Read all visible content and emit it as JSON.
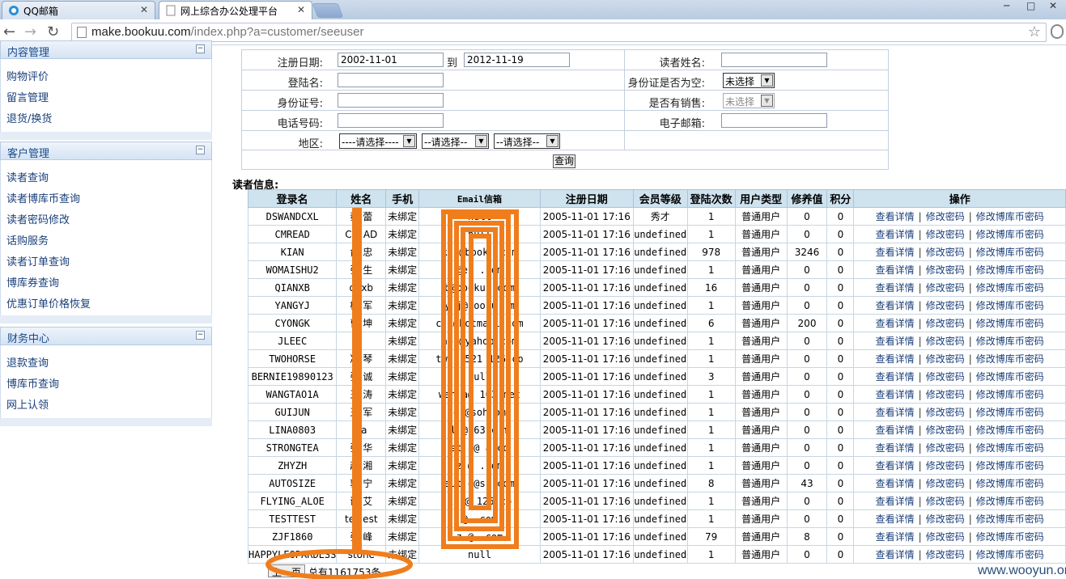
{
  "browser": {
    "tabs": [
      {
        "title": "QQ邮箱",
        "active": false
      },
      {
        "title": "网上综合办公处理平台",
        "active": true
      }
    ],
    "url_host": "make.bookuu.com",
    "url_path": "/index.php?a=customer/seeuser",
    "window_controls": [
      "─",
      "□",
      "✕"
    ]
  },
  "sidebar": {
    "sections": [
      {
        "title": "内容管理",
        "items": [
          "购物评价",
          "留言管理",
          "退货/换货"
        ]
      },
      {
        "title": "客户管理",
        "items": [
          "读者查询",
          "读者博库币查询",
          "读者密码修改",
          "话购服务",
          "读者订单查询",
          "博库券查询",
          "优惠订单价格恢复"
        ]
      },
      {
        "title": "财务中心",
        "items": [
          "退款查询",
          "博库币查询",
          "网上认领"
        ]
      }
    ]
  },
  "form": {
    "reg_date_label": "注册日期:",
    "reg_date_from": "2002-11-01",
    "to_label": "到",
    "reg_date_to": "2012-11-19",
    "reader_name_label": "读者姓名:",
    "login_label": "登陆名:",
    "idcard_empty_label": "身份证是否为空:",
    "idcard_empty_value": "未选择",
    "idcard_label": "身份证号:",
    "has_sale_label": "是否有销售:",
    "has_sale_value": "未选择",
    "phone_label": "电话号码:",
    "email_label": "电子邮箱:",
    "region_label": "地区:",
    "region_sel1": "----请选择----",
    "region_sel2": "--请选择--",
    "region_sel3": "--请选择--",
    "query_button": "查询"
  },
  "section_title": "读者信息:",
  "table": {
    "headers": [
      "登录名",
      "姓名",
      "手机",
      "Email信箱",
      "注册日期",
      "会员等级",
      "登陆次数",
      "用户类型",
      "修养值",
      "积分",
      "操作"
    ],
    "rows": [
      [
        "DSWANDCXL",
        "蔡 蕾",
        "未绑定",
        "null",
        "2005-11-01 17:16",
        "秀才",
        "1",
        "普通用户",
        "0",
        "0"
      ],
      [
        "CMREAD",
        "CM AD",
        "未绑定",
        "null",
        "2005-11-01 17:16",
        "undefined",
        "1",
        "普通用户",
        "0",
        "0"
      ],
      [
        "KIAN",
        "俞 忠",
        "未绑定",
        "k  n@book  .c m",
        "2005-11-01 17:16",
        "undefined",
        "978",
        "普通用户",
        "3246",
        "0"
      ],
      [
        "WOMAISHU2",
        "张 生",
        "未绑定",
        "  @es  .com",
        "2005-11-01 17:16",
        "undefined",
        "1",
        "普通用户",
        "0",
        "0"
      ],
      [
        "QIANXB",
        "qi  xb",
        "未绑定",
        "  b@booku  .com",
        "2005-11-01 17:16",
        "undefined",
        "16",
        "普通用户",
        "0",
        "0"
      ],
      [
        "YANGYJ",
        "杨 军",
        "未绑定",
        "y  j@boo  u.  m",
        "2005-11-01 17:16",
        "undefined",
        "1",
        "普通用户",
        "0",
        "0"
      ],
      [
        "CYONGK",
        "曹 坤",
        "未绑定",
        "c  k@hotma l.com",
        "2005-11-01 17:16",
        "undefined",
        "6",
        "普通用户",
        "200",
        "0"
      ],
      [
        "JLEEC",
        "",
        "未绑定",
        "ap  @yahoo.com",
        "2005-11-01 17:16",
        "undefined",
        "1",
        "普通用户",
        "0",
        "0"
      ],
      [
        "TWOHORSE",
        "冯 琴",
        "未绑定",
        "tw  s 521 126.co",
        "2005-11-01 17:16",
        "undefined",
        "1",
        "普通用户",
        "0",
        "0"
      ],
      [
        "BERNIE19890123",
        "张 诚",
        "未绑定",
        "null",
        "2005-11-01 17:16",
        "undefined",
        "3",
        "普通用户",
        "0",
        "0"
      ],
      [
        "WANGTAO1A",
        "王 涛",
        "未绑定",
        "wan  a@  163.net",
        "2005-11-01 17:16",
        "undefined",
        "1",
        "普通用户",
        "0",
        "0"
      ],
      [
        "GUIJUN",
        "王 军",
        "未绑定",
        "g  @soh  om",
        "2005-11-01 17:16",
        "undefined",
        "1",
        "普通用户",
        "0",
        "0"
      ],
      [
        "LINA0803",
        "l  a",
        "未绑定",
        "l  @163.c m",
        "2005-11-01 17:16",
        "undefined",
        "1",
        "普通用户",
        "0",
        "0"
      ],
      [
        "STRONGTEA",
        "张 华",
        "未绑定",
        "st  a@  a.co",
        "2005-11-01 17:16",
        "undefined",
        "1",
        "普通用户",
        "0",
        "0"
      ],
      [
        "ZHYZH",
        "赵 湘",
        "未绑定",
        "z  @  .com",
        "2005-11-01 17:16",
        "undefined",
        "1",
        "普通用户",
        "0",
        "0"
      ],
      [
        "AUTOSIZE",
        "郭 宁",
        "未绑定",
        "aut  e@s  .com",
        "2005-11-01 17:16",
        "undefined",
        "8",
        "普通用户",
        "43",
        "0"
      ],
      [
        "FLYING_ALOE",
        "谢 艾",
        "未绑定",
        "xi  @  126.co",
        "2005-11-01 17:16",
        "undefined",
        "1",
        "普通用户",
        "0",
        "0"
      ],
      [
        "TESTTEST",
        "tes  est",
        "未绑定",
        "  @  .com",
        "2005-11-01 17:16",
        "undefined",
        "1",
        "普通用户",
        "0",
        "0"
      ],
      [
        "ZJF1860",
        "张 峰",
        "未绑定",
        "z  @  .com",
        "2005-11-01 17:16",
        "undefined",
        "79",
        "普通用户",
        "8",
        "0"
      ],
      [
        "HAPPYLEOPARDESS",
        "stone  ",
        "未绑定",
        "null",
        "2005-11-01 17:16",
        "undefined",
        "1",
        "普通用户",
        "0",
        "0"
      ]
    ],
    "op_view": "查看详情",
    "op_pwd": "修改密码",
    "op_coin_pwd": "修改博库币密码",
    "op_sep": "|"
  },
  "pager": {
    "prev_button": "上一页",
    "total_text": "总有1161753条"
  },
  "watermark": "www.wooyun.org",
  "colors": {
    "annotation": "#f07d1c",
    "sidebar_header": "#1a4b8c",
    "table_header": "#cfe3ef"
  }
}
